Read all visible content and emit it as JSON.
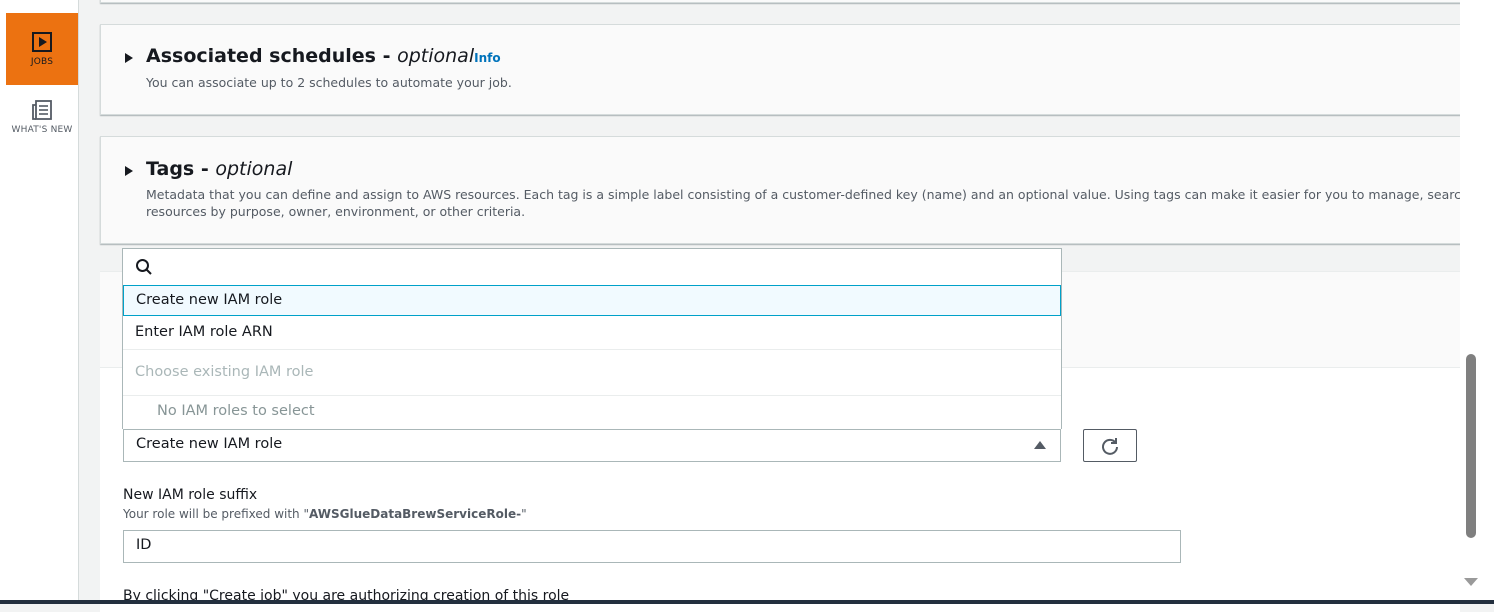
{
  "rail": {
    "jobs_label": "JOBS",
    "whatsnew_label": "WHAT'S NEW"
  },
  "sections": {
    "schedules": {
      "title": "Associated schedules - ",
      "optional": "optional",
      "info": "Info",
      "description": "You can associate up to 2 schedules to automate your job."
    },
    "tags": {
      "title": "Tags - ",
      "optional": "optional",
      "description_line1": "Metadata that you can define and assign to AWS resources. Each tag is a simple label consisting of a customer-defined key (name) and an optional value. Using tags can make it easier for you to manage, search for, ar",
      "description_line2": "resources by purpose, owner, environment, or other criteria."
    }
  },
  "dropdown": {
    "search_placeholder": "",
    "options": [
      {
        "label": "Create new IAM role",
        "selected": true
      },
      {
        "label": "Enter IAM role ARN",
        "selected": false
      }
    ],
    "group_label": "Choose existing IAM role",
    "empty_text": "No IAM roles to select"
  },
  "role_select": {
    "value": "Create new IAM role"
  },
  "suffix": {
    "label": "New IAM role suffix",
    "hint_prefix": "Your role will be prefixed with \"",
    "hint_bold": "AWSGlueDataBrewServiceRole-",
    "hint_suffix": "\"",
    "value": "ID"
  },
  "footer_note": "By clicking \"Create job\" you are authorizing creation of this role",
  "colors": {
    "accent": "#ec7211",
    "link": "#0073bb",
    "focus": "#00a1c9"
  }
}
